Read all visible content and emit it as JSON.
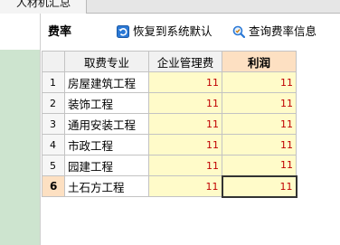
{
  "tabs": [
    {
      "label": "人材机汇总"
    }
  ],
  "toolbar": {
    "title": "费率",
    "restore_label": "恢复到系统默认",
    "query_label": "查询费率信息"
  },
  "grid": {
    "columns": [
      "取费专业",
      "企业管理费",
      "利润"
    ],
    "rows": [
      {
        "num": "1",
        "name": "房屋建筑工程",
        "mgmt": "11",
        "profit": "11"
      },
      {
        "num": "2",
        "name": "装饰工程",
        "mgmt": "11",
        "profit": "11"
      },
      {
        "num": "3",
        "name": "通用安装工程",
        "mgmt": "11",
        "profit": "11"
      },
      {
        "num": "4",
        "name": "市政工程",
        "mgmt": "11",
        "profit": "11"
      },
      {
        "num": "5",
        "name": "园建工程",
        "mgmt": "11",
        "profit": "11"
      },
      {
        "num": "6",
        "name": "土石方工程",
        "mgmt": "11",
        "profit": "11"
      }
    ],
    "selected_row": 5
  },
  "colors": {
    "value_text": "#c00000",
    "value_bg": "#fffbc9",
    "header_highlight": "#fde0c2",
    "left_strip": "#cde4cf"
  },
  "icons": {
    "restore": "restore-arrow-icon",
    "query": "magnifier-icon"
  }
}
